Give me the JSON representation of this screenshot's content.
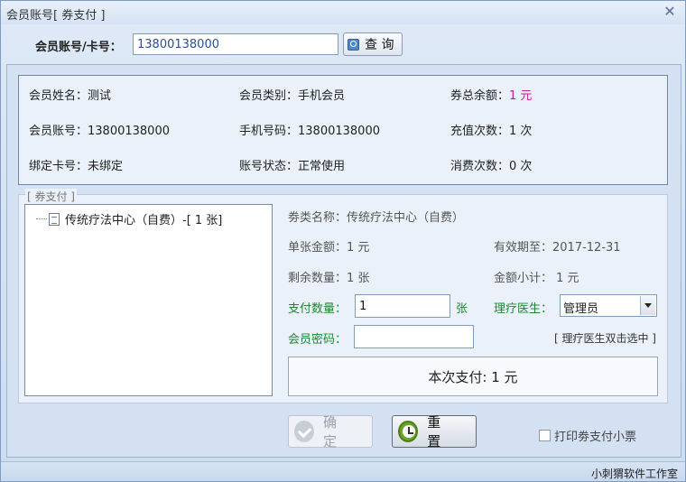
{
  "window": {
    "title": "会员账号[ 券支付 ]",
    "close_glyph": "✕"
  },
  "search": {
    "label": "会员账号/卡号：",
    "value": "13800138000",
    "button_label": "查 询"
  },
  "member_info": {
    "name_label": "会员姓名：",
    "name_value": "测试",
    "type_label": "会员类别：",
    "type_value": "手机会员",
    "balance_label": "券总余额：",
    "balance_value": "1 元",
    "account_label": "会员账号：",
    "account_value": "13800138000",
    "phone_label": "手机号码：",
    "phone_value": "13800138000",
    "recharge_label": "充值次数：",
    "recharge_value": "1 次",
    "card_label": "绑定卡号：",
    "card_value": "未绑定",
    "status_label": "账号状态：",
    "status_value": "正常使用",
    "consume_label": "消费次数：",
    "consume_value": "0 次"
  },
  "voucher": {
    "legend": "[ 券支付 ]",
    "tree_item": "传统疗法中心（自费）-[ 1 张]",
    "type_name": "劵类名称：传统疗法中心（自费）",
    "unit_amount": "单张金额：1 元",
    "expiry": "有效期至：2017-12-31",
    "remaining": "剩余数量：1 张",
    "subtotal": "金额小计： 1 元",
    "pay_qty_label": "支付数量：",
    "pay_qty_value": "1",
    "pay_qty_unit": "张",
    "doctor_label": "理疗医生：",
    "doctor_value": "管理员",
    "password_label": "会员密码：",
    "password_value": "",
    "doctor_hint": "[ 理疗医生双击选中 ]",
    "pay_total": "本次支付: 1 元"
  },
  "actions": {
    "confirm_label": "确 定",
    "reset_label": "重 置",
    "print_label": "打印劵支付小票",
    "print_checked": false
  },
  "status": {
    "text": "小刺猬软件工作室"
  },
  "colors": {
    "accent_pink": "#c71aa2",
    "label_green": "#1b8a2e",
    "input_text_blue": "#2a4f9a"
  }
}
